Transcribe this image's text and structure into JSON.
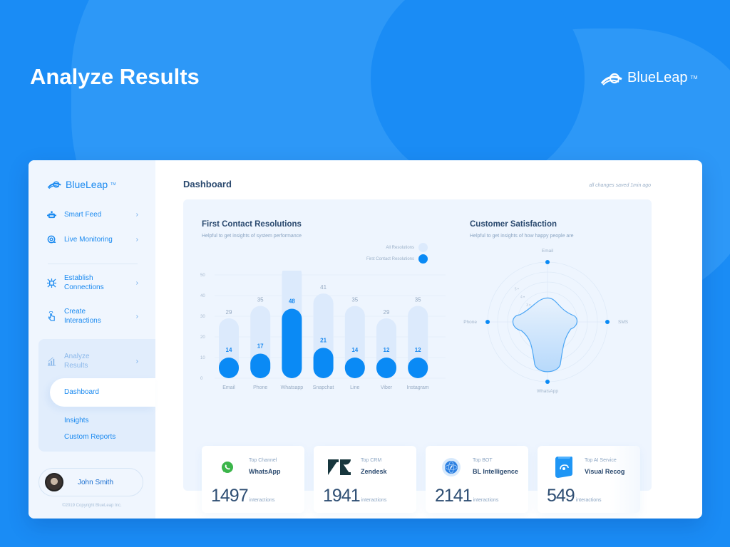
{
  "hero": {
    "title": "Analyze Results",
    "brand": "BlueLeap",
    "brand_tm": "TM"
  },
  "sidebar": {
    "brand": "BlueLeap",
    "brand_tm": "TM",
    "items": [
      {
        "label": "Smart Feed",
        "icon": "robot-icon"
      },
      {
        "label": "Live Monitoring",
        "icon": "monitoring-icon"
      },
      {
        "label": "Establish Connections",
        "icon": "connections-icon"
      },
      {
        "label": "Create Interactions",
        "icon": "touch-icon"
      },
      {
        "label": "Analyze Results",
        "icon": "bar-chart-icon"
      }
    ],
    "subitems": [
      {
        "label": "Dashboard",
        "active": true
      },
      {
        "label": "Insights",
        "active": false
      },
      {
        "label": "Custom Reports",
        "active": false
      }
    ],
    "user": {
      "name": "John Smith"
    },
    "copyright": "©2019 Copyright BlueLeap Inc."
  },
  "main": {
    "title": "Dashboard",
    "saved_note": "all changes saved 1min ago"
  },
  "colors": {
    "accent": "#0a8af5",
    "accent_light": "#dceafc",
    "background": "#1a8cf5",
    "panel": "#eef5fe"
  },
  "chart_data": [
    {
      "type": "bar",
      "title": "First Contact Resolutions",
      "subtitle": "Helpful to get insights of system performance",
      "categories": [
        "Email",
        "Phone",
        "Whatsapp",
        "Snapchat",
        "Line",
        "Viber",
        "Instagram"
      ],
      "series": [
        {
          "name": "All Resolutions",
          "values": [
            29,
            35,
            55,
            41,
            35,
            29,
            35
          ],
          "color": "#dceafc"
        },
        {
          "name": "First Contact Resolutions",
          "values": [
            14,
            17,
            48,
            21,
            14,
            12,
            12
          ],
          "color": "#0a8af5"
        }
      ],
      "yticks": [
        0,
        10,
        20,
        30,
        40,
        50
      ],
      "ylim": [
        0,
        50
      ],
      "legend": "top-right",
      "grid": true,
      "xlabel": "",
      "ylabel": ""
    },
    {
      "type": "radar",
      "title": "Customer Satisfaction",
      "subtitle": "Helpful to get insights of how happy people are",
      "axes": [
        "Email",
        "SMS",
        "WhatsApp",
        "Phone"
      ],
      "values": [
        2.4,
        2.9,
        5.1,
        3.5
      ],
      "rings": [
        1,
        2,
        3,
        4,
        5
      ],
      "ring_labels": [
        "1",
        "2",
        "3",
        "4",
        "5"
      ],
      "rmax": 6
    }
  ],
  "stats": [
    {
      "label": "Top Channel",
      "name": "WhatsApp",
      "value": "1497",
      "unit": "interactions",
      "icon": "whatsapp-icon"
    },
    {
      "label": "Top CRM",
      "name": "Zendesk",
      "value": "1941",
      "unit": "interactions",
      "icon": "zendesk-icon"
    },
    {
      "label": "Top BOT",
      "name": "BL Intelligence",
      "value": "2141",
      "unit": "interactions",
      "icon": "bot-icon"
    },
    {
      "label": "Top AI Service",
      "name": "Visual Recog",
      "value": "549",
      "unit": "interactions",
      "icon": "ai-service-icon"
    }
  ]
}
